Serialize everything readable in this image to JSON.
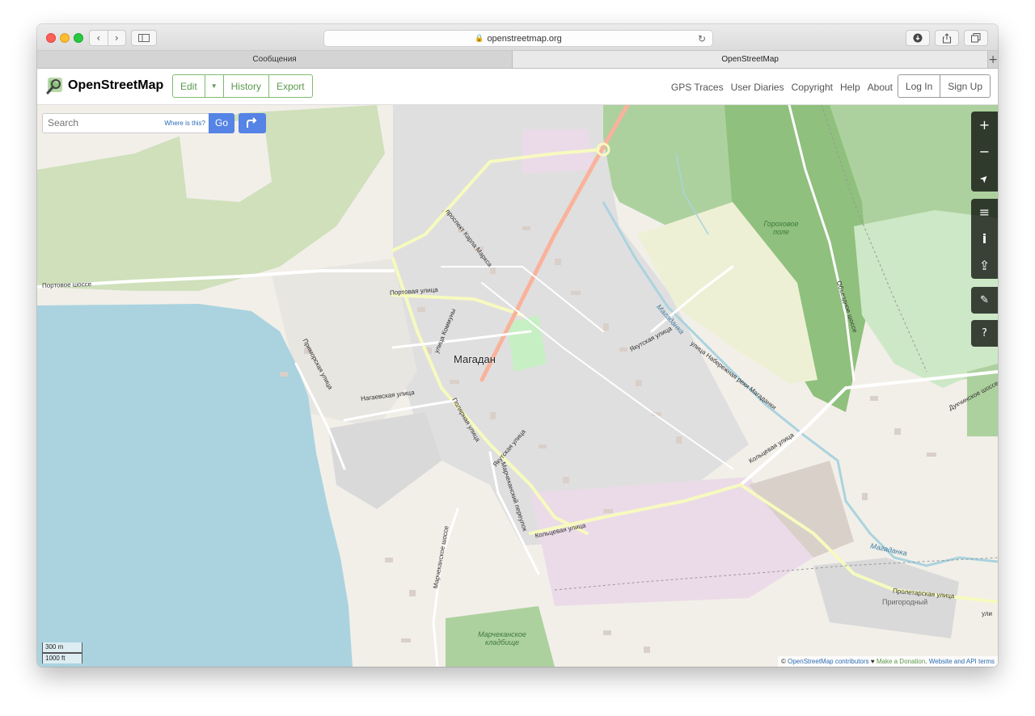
{
  "browser": {
    "address": "openstreetmap.org",
    "tabs": [
      {
        "label": "Сообщения",
        "active": false
      },
      {
        "label": "OpenStreetMap",
        "active": true
      }
    ],
    "new_tab": "+"
  },
  "header": {
    "logo_text": "OpenStreetMap",
    "edit_buttons": [
      "Edit",
      "History",
      "Export"
    ],
    "nav_links": [
      "GPS Traces",
      "User Diaries",
      "Copyright",
      "Help",
      "About"
    ],
    "auth": {
      "login": "Log In",
      "signup": "Sign Up"
    },
    "accent_color": "#7ebc6f"
  },
  "search": {
    "placeholder": "Search",
    "where_link": "Where is this?",
    "go_label": "Go",
    "button_color": "#5583e6"
  },
  "controls": [
    {
      "name": "zoom-in",
      "glyph": "+"
    },
    {
      "name": "zoom-out",
      "glyph": "−"
    },
    {
      "name": "locate",
      "glyph": "➤"
    },
    {
      "name": "layers",
      "glyph": "≡"
    },
    {
      "name": "info",
      "glyph": "i"
    },
    {
      "name": "share",
      "glyph": "⇪"
    },
    {
      "name": "add-note",
      "glyph": "✎"
    },
    {
      "name": "query",
      "glyph": "?"
    }
  ],
  "map": {
    "city": "Магадан",
    "labels": {
      "portovoe_shosse": "Портовое шоссе",
      "portovaya": "Портовая улица",
      "karla_marksa": "проспект Карла Маркса",
      "kommuny": "улица Коммуны",
      "primorskaya": "Приморская улица",
      "nagaevskaya": "Нагаевская улица",
      "polyarnaya": "Полярная улица",
      "yakutskaya_1": "Якутская улица",
      "yakutskaya_2": "Якутская улица",
      "marchekanskiy": "Марчеканский переулок",
      "marchekanskoe_sh": "Марчеканское шоссе",
      "koltsevaya_1": "Кольцевая улица",
      "koltsevaya_2": "Кольцевая улица",
      "naberezhnaya": "улица Набережная реки Магаданки",
      "magadanka_1": "Магаданка",
      "magadanka_2": "Магаданка",
      "gorokhovoe": "Гороховое поле",
      "obezdnoe": "Объездное шоссе",
      "dukchinskoe": "Дукчинское шоссе",
      "proletarskaya": "Пролетарская улица",
      "prigorodny": "Пригородный",
      "cemetery": "Марчеканское кладбище",
      "ulitsa": "ули"
    },
    "colors": {
      "land": "#f2efe9",
      "water": "#aad3df",
      "forest": "#add19e",
      "residential": "#e0dfdf",
      "industrial": "#ebdbe8",
      "road_primary": "#fcd6a4",
      "road_trunk": "#f9b29c",
      "road_secondary": "#f7fabf"
    }
  },
  "scale": {
    "metric": "300 m",
    "imperial": "1000 ft"
  },
  "attribution": {
    "prefix": "© ",
    "contributors": "OpenStreetMap contributors",
    "heart": " ♥ ",
    "donation": "Make a Donation",
    "separator": ". ",
    "terms": "Website and API terms"
  }
}
